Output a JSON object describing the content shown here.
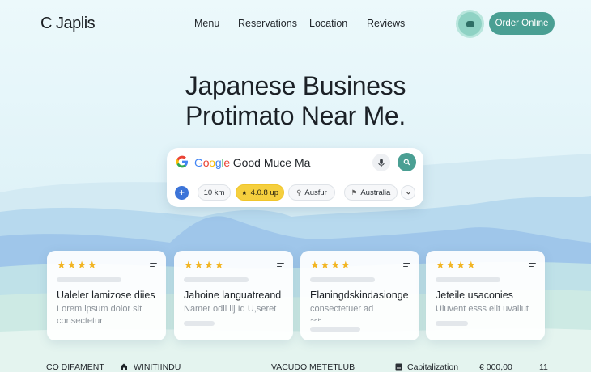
{
  "brand": {
    "name": "C Japlis"
  },
  "nav": {
    "links": [
      "Menu",
      "Reservations",
      "Location",
      "Reviews"
    ],
    "order_label": "Order Online"
  },
  "hero": {
    "title_line1": "Japanese Business",
    "title_line2": "Protimato Near Me."
  },
  "search": {
    "google_word": "Google",
    "query": "Good Muce Ma",
    "chips": {
      "distance": "10 km",
      "rating": "4.0.8 up",
      "filter": "Ausfur",
      "region": "Australia"
    }
  },
  "cards": [
    {
      "stars": "★★★★",
      "title": "Ualeler lamizose diies",
      "line1": "Lorem ipsum dolor sit",
      "line2": "consectetur"
    },
    {
      "stars": "★★★★",
      "title": "Jahoine languatreand",
      "line1": "Namer odil lij Id U,seret",
      "line2": ""
    },
    {
      "stars": "★★★★",
      "title": "Elaningdskindasionge",
      "line1": "consectetuer ad",
      "line2": "ash"
    },
    {
      "stars": "★★★★",
      "title": "Jeteile usaconies",
      "line1": "Uluvent esss elit uvailut",
      "line2": ""
    }
  ],
  "footer": {
    "col1": "CO DIFAMENT",
    "col2": "WINITIINDU",
    "col3": "VACUDO METETLUB",
    "col4": "Capitalization",
    "price": "€ 000,00",
    "count": "11"
  },
  "colors": {
    "accent": "#4a9f93",
    "star": "#f2b523",
    "rating_chip": "#f5cf3e",
    "background": "#eaf7fb"
  },
  "icons": [
    "chat-icon",
    "google-g-icon",
    "microphone-icon",
    "search-icon",
    "plus-icon",
    "star-icon",
    "chevron-down-icon",
    "menu-lines-icon",
    "home-icon",
    "tag-icon"
  ]
}
